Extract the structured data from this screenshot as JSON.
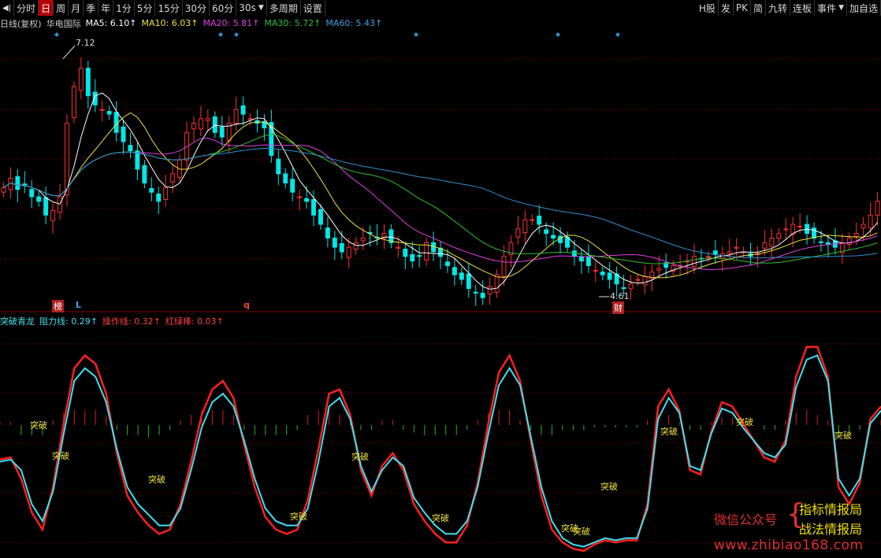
{
  "toolbar": {
    "left_buttons": [
      "分时",
      "日",
      "周",
      "月",
      "季",
      "年",
      "1分",
      "5分",
      "15分",
      "30分",
      "60分",
      "30s",
      "多周期",
      "设置"
    ],
    "active": "日",
    "right_buttons": [
      "H股",
      "发",
      "PK",
      "简",
      "九转",
      "连板",
      "事件",
      "加自选"
    ]
  },
  "main_legend": {
    "period": "日线(复权)",
    "stock_name": "华电国际",
    "ma5": "MA5: 6.10↑",
    "ma10": "MA10: 6.03↑",
    "ma20": "MA20: 5.81↑",
    "ma30": "MA30: 5.72↑",
    "ma60": "MA60: 5.43↑"
  },
  "sub_legend": {
    "indicator": "突破青龙",
    "resistance": "阻力线: 0.29↑",
    "operation": "操作线: 0.32↑",
    "redgreen": "红绿棒: 0.03↑"
  },
  "markers": {
    "high_price": "7.12",
    "low_price": "4.61",
    "bang": "榜",
    "l_mark": "L",
    "q_mark": "q",
    "cai": "财",
    "signal": "突破"
  },
  "watermark": {
    "wechat": "微信公众号",
    "name1": "指标情报局",
    "name2": "战法情报局",
    "url": "www.zhibiao168.com"
  },
  "colors": {
    "up": "#ff3030",
    "down": "#00e8e8",
    "ma5": "#ffffff",
    "ma10": "#f0e040",
    "ma20": "#e040e0",
    "ma30": "#30c030",
    "ma60": "#3090d0",
    "resistance_line": "#40e0f0",
    "operation_line": "#ff2020",
    "signal_text": "#f0e040"
  },
  "chart_data": [
    {
      "type": "candlestick",
      "title": "",
      "series": [
        {
          "name": "MA5",
          "values": []
        },
        {
          "name": "MA10",
          "values": []
        },
        {
          "name": "MA20",
          "values": []
        },
        {
          "name": "MA30",
          "values": []
        },
        {
          "name": "MA60",
          "values": []
        }
      ],
      "close_values": [
        5.7,
        5.8,
        5.68,
        5.72,
        5.6,
        5.55,
        5.4,
        5.45,
        5.6,
        6.4,
        6.8,
        7.0,
        6.7,
        6.6,
        6.55,
        6.5,
        6.3,
        6.2,
        6.1,
        5.9,
        5.75,
        5.65,
        5.55,
        5.7,
        5.85,
        6.0,
        6.3,
        6.4,
        6.45,
        6.45,
        6.3,
        6.25,
        6.4,
        6.55,
        6.5,
        6.45,
        6.4,
        6.35,
        6.05,
        5.85,
        5.75,
        5.65,
        5.6,
        5.55,
        5.4,
        5.3,
        5.15,
        5.05,
        5.0,
        5.05,
        5.1,
        5.15,
        5.2,
        5.15,
        5.2,
        5.1,
        5.05,
        4.95,
        4.9,
        4.95,
        5.1,
        5.0,
        4.95,
        4.85,
        4.75,
        4.7,
        4.6,
        4.55,
        4.5,
        4.62,
        4.75,
        4.95,
        5.1,
        5.25,
        5.35,
        5.35,
        5.3,
        5.2,
        5.15,
        5.1,
        5.05,
        4.95,
        4.9,
        4.85,
        4.8,
        4.75,
        4.7,
        4.65,
        4.6,
        4.65,
        4.7,
        4.73,
        4.78,
        4.82,
        4.83,
        4.85,
        4.85,
        4.9,
        4.95,
        4.93,
        4.95,
        4.97,
        4.98,
        5.0,
        5.05,
        5.0,
        4.95,
        4.98,
        5.1,
        5.15,
        5.2,
        5.25,
        5.3,
        5.28,
        5.2,
        5.15,
        5.1,
        5.08,
        5.05,
        5.1,
        5.15,
        5.2,
        5.3,
        5.4,
        5.55
      ],
      "annotations": [
        "7.12",
        "4.61"
      ]
    },
    {
      "type": "line",
      "series": [
        {
          "name": "阻力线",
          "values": [
            0.42,
            0.43,
            0.38,
            0.22,
            0.14,
            0.28,
            0.55,
            0.8,
            0.86,
            0.82,
            0.7,
            0.48,
            0.3,
            0.22,
            0.17,
            0.12,
            0.12,
            0.2,
            0.38,
            0.58,
            0.7,
            0.74,
            0.68,
            0.52,
            0.34,
            0.2,
            0.14,
            0.12,
            0.12,
            0.2,
            0.42,
            0.68,
            0.72,
            0.62,
            0.4,
            0.28,
            0.38,
            0.44,
            0.4,
            0.25,
            0.18,
            0.12,
            0.08,
            0.08,
            0.14,
            0.3,
            0.55,
            0.78,
            0.86,
            0.78,
            0.54,
            0.3,
            0.14,
            0.06,
            0.03,
            0.02,
            0.04,
            0.06,
            0.05,
            0.06,
            0.06,
            0.2,
            0.62,
            0.72,
            0.65,
            0.4,
            0.38,
            0.55,
            0.67,
            0.65,
            0.58,
            0.52,
            0.46,
            0.44,
            0.5,
            0.77,
            0.9,
            0.92,
            0.8,
            0.34,
            0.26,
            0.34,
            0.6,
            0.66
          ]
        },
        {
          "name": "操作线",
          "values": [
            0.43,
            0.44,
            0.34,
            0.18,
            0.1,
            0.3,
            0.6,
            0.86,
            0.92,
            0.88,
            0.74,
            0.46,
            0.26,
            0.18,
            0.12,
            0.08,
            0.1,
            0.22,
            0.42,
            0.64,
            0.76,
            0.8,
            0.72,
            0.5,
            0.3,
            0.16,
            0.1,
            0.08,
            0.1,
            0.24,
            0.48,
            0.74,
            0.76,
            0.64,
            0.38,
            0.26,
            0.4,
            0.46,
            0.38,
            0.22,
            0.14,
            0.08,
            0.04,
            0.04,
            0.12,
            0.32,
            0.6,
            0.84,
            0.92,
            0.8,
            0.52,
            0.26,
            0.1,
            0.04,
            0.01,
            0.0,
            0.03,
            0.05,
            0.04,
            0.05,
            0.05,
            0.22,
            0.68,
            0.76,
            0.66,
            0.38,
            0.36,
            0.56,
            0.7,
            0.68,
            0.6,
            0.52,
            0.44,
            0.42,
            0.52,
            0.82,
            0.96,
            0.96,
            0.82,
            0.3,
            0.22,
            0.32,
            0.62,
            0.68
          ]
        }
      ],
      "signals": [
        "突破",
        "突破",
        "突破",
        "突破",
        "突破",
        "突破",
        "突破",
        "突破",
        "突破",
        "突破",
        "突破",
        "突破"
      ]
    }
  ]
}
